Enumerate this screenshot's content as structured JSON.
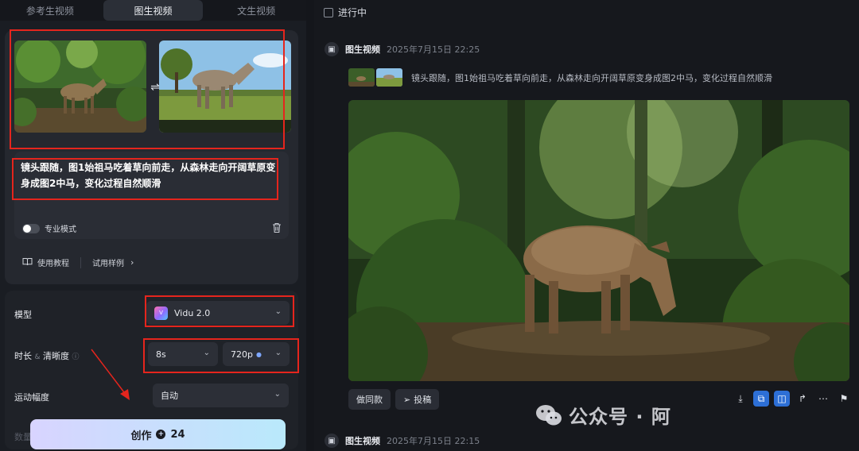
{
  "tabs": [
    "参考生视频",
    "图生视频",
    "文生视频"
  ],
  "active_tab": "图生视频",
  "left": {
    "prompt": "镜头跟随，图1始祖马吃着草向前走，从森林走向开阔草原变身成图2中马，变化过程自然顺滑",
    "pro_mode_label": "专业模式",
    "tutorial_label": "使用教程",
    "try_sample_label": "试用样例",
    "model_label": "模型",
    "model_value": "Vidu 2.0",
    "duration_label": "时长",
    "amp": "&",
    "clarity_label": "清晰度",
    "duration_value": "8s",
    "clarity_value": "720p",
    "motion_label": "运动幅度",
    "motion_value": "自动",
    "faded_label": "数量",
    "create_label": "创作",
    "create_cost": "24"
  },
  "right": {
    "in_progress_label": "进行中",
    "entries": [
      {
        "type": "图生视频",
        "time": "2025年7月15日 22:25"
      },
      {
        "type": "图生视频",
        "time": "2025年7月15日 22:15"
      }
    ],
    "ref_prompt": "镜头跟随，图1始祖马吃着草向前走，从森林走向开阔草原变身成图2中马，变化过程自然顺滑",
    "same_style_label": "做同款",
    "submit_label": "投稿",
    "watermark": "公众号 · 阿"
  },
  "colors": {
    "highlight_red": "#e5251d",
    "accent_blue": "#2d6fd6"
  }
}
